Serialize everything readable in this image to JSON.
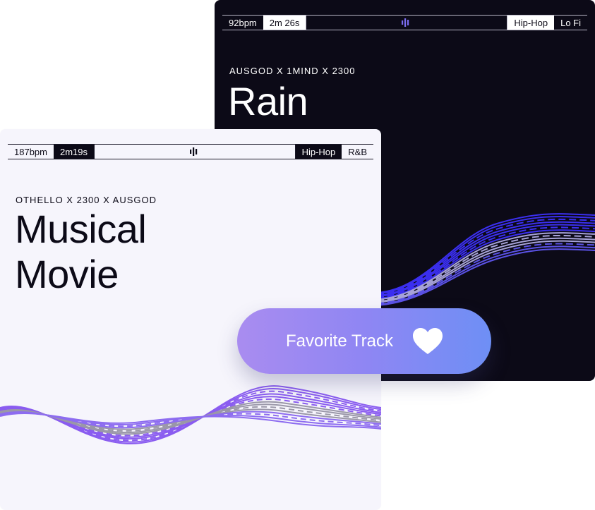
{
  "tracks": [
    {
      "bpm": "92bpm",
      "duration": "2m 26s",
      "genres": [
        "Hip-Hop",
        "Lo Fi"
      ],
      "artists": "AUSGOD X 1MIND X 2300",
      "title": "Rain"
    },
    {
      "bpm": "187bpm",
      "duration": "2m19s",
      "genres": [
        "Hip-Hop",
        "R&B"
      ],
      "artists": "OTHELLO X 2300 X AUSGOD",
      "title_line1": "Musical",
      "title_line2": "Movie"
    }
  ],
  "favorite": {
    "label": "Favorite Track"
  },
  "colors": {
    "dark_card": "#0c0a17",
    "light_card": "#f6f5fc",
    "accent_blue": "#3b2ff0",
    "accent_purple": "#8a5cf0",
    "button_start": "#a98cf0",
    "button_end": "#6e8ff5"
  },
  "icons": [
    "audio-wave-icon",
    "heart-icon"
  ]
}
